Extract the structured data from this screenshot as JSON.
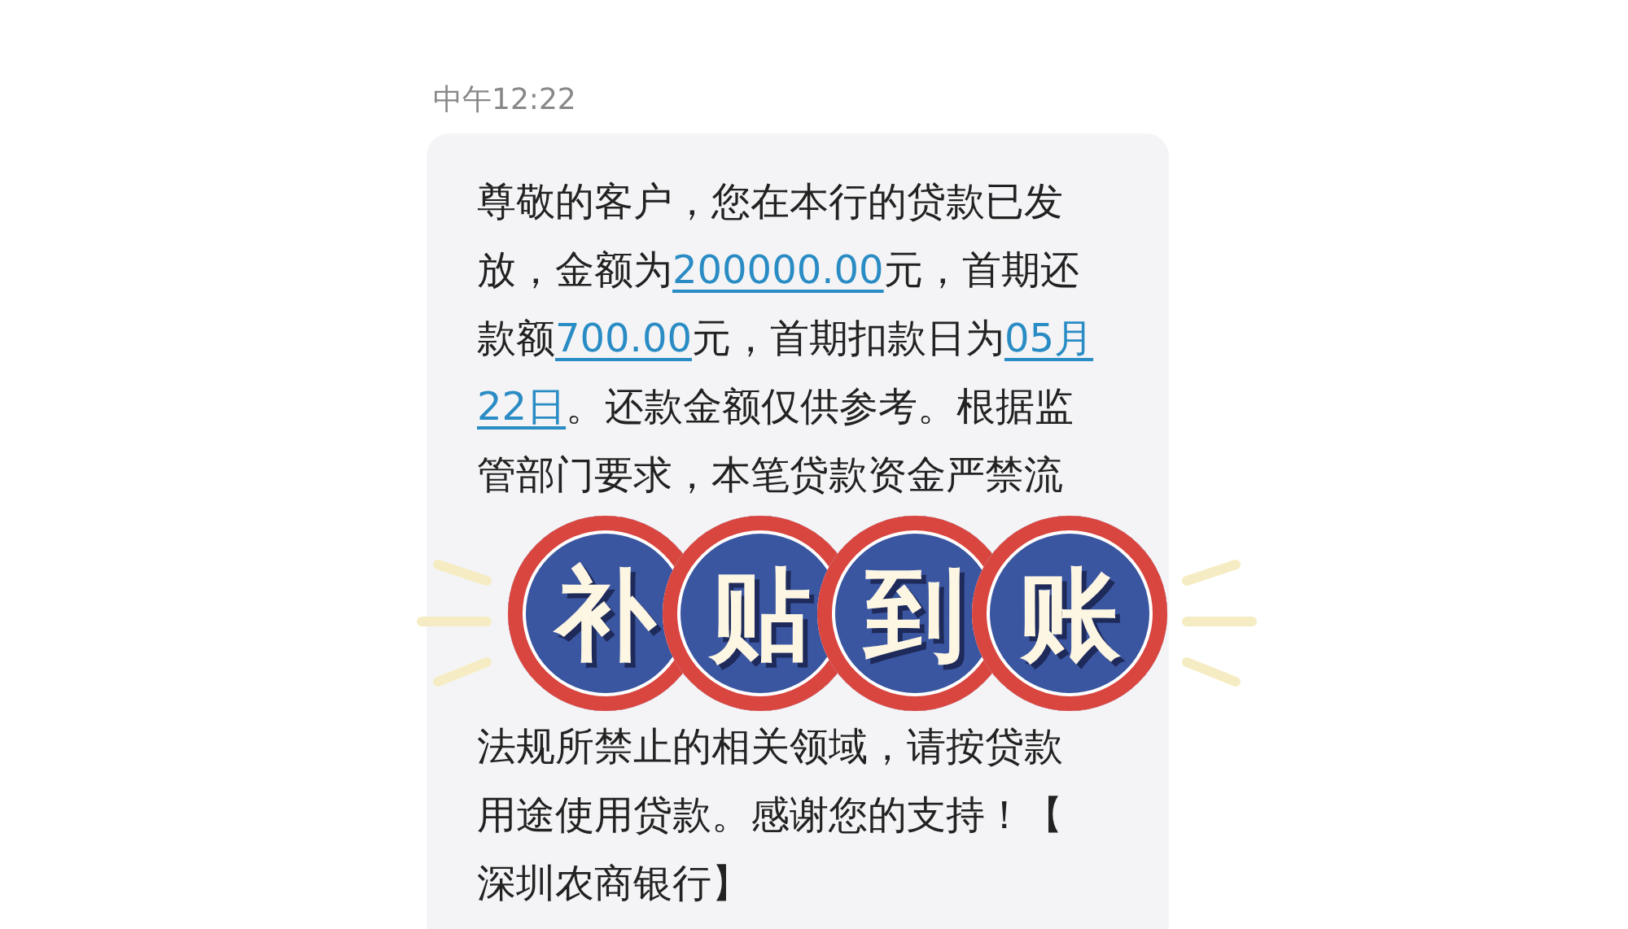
{
  "message": {
    "time": "中午12:22",
    "paragraphs": [
      [
        {
          "kind": "text",
          "text": "尊敬的客户，您在本行的贷款已发放，金额为"
        },
        {
          "kind": "link",
          "text": "200000.00"
        },
        {
          "kind": "text",
          "text": "元，首期还款额"
        },
        {
          "kind": "link",
          "text": "700.00"
        },
        {
          "kind": "text",
          "text": "元，首期扣款日为"
        },
        {
          "kind": "link",
          "text": "05月"
        },
        {
          "kind": "link",
          "text": "22日"
        },
        {
          "kind": "text",
          "text": "。还款金额仅供参考。根据监管部门要求，本笔贷款资金严禁流"
        }
      ],
      [
        {
          "kind": "text",
          "text": "法规所禁止的相关领域，请按贷款用途使用贷款。感谢您的支持！【深圳农商银行】"
        }
      ]
    ]
  },
  "sticker": {
    "characters": [
      "补",
      "贴",
      "到",
      "账"
    ]
  }
}
